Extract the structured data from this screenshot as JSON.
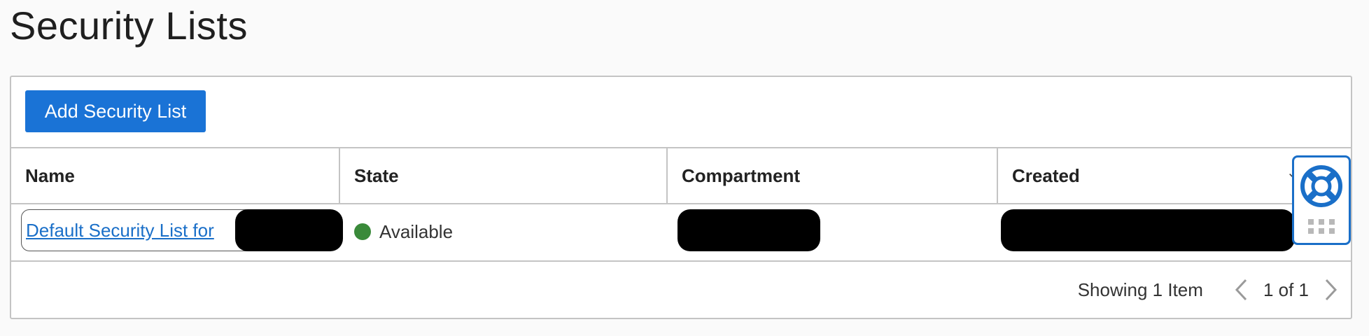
{
  "page": {
    "title": "Security Lists"
  },
  "toolbar": {
    "add_label": "Add Security List"
  },
  "table": {
    "columns": [
      "Name",
      "State",
      "Compartment",
      "Created"
    ],
    "rows": [
      {
        "name": "Default Security List for",
        "state": "Available",
        "state_color": "#3a8a3a"
      }
    ]
  },
  "pagination": {
    "showing": "Showing 1 Item",
    "page_label": "1 of 1"
  },
  "help_widget": {
    "icons": [
      "lifebuoy-icon",
      "grid-dots-icon"
    ]
  },
  "colors": {
    "accent": "#1a73d6",
    "link": "#1a6fc8",
    "border": "#c4c4c4"
  }
}
